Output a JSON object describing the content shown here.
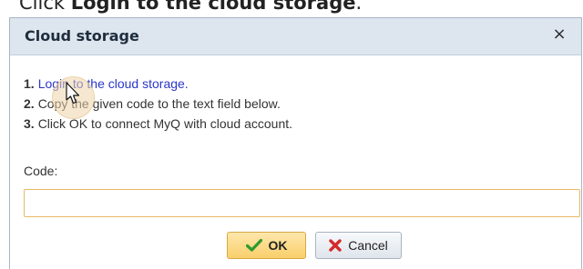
{
  "caption": {
    "prefix": "Click ",
    "bold": "Login to the cloud storage",
    "suffix": "."
  },
  "dialog": {
    "title": "Cloud storage",
    "close_glyph": "×",
    "steps": [
      {
        "num": "1.",
        "text": "Login to the cloud storage."
      },
      {
        "num": "2.",
        "text": "Copy the given code to the text field below."
      },
      {
        "num": "3.",
        "text": "Click OK to connect MyQ with cloud account."
      }
    ],
    "code_label": "Code:",
    "code_value": "",
    "buttons": {
      "ok": "OK",
      "cancel": "Cancel"
    }
  },
  "icons": {
    "ok": "checkmark-icon",
    "cancel": "red-x-icon",
    "cursor": "mouse-pointer-icon"
  },
  "colors": {
    "link": "#2a36c8",
    "titlebar": "#dde5ef",
    "ok_button": "#f9cf6b",
    "input_border": "#e9b866"
  }
}
